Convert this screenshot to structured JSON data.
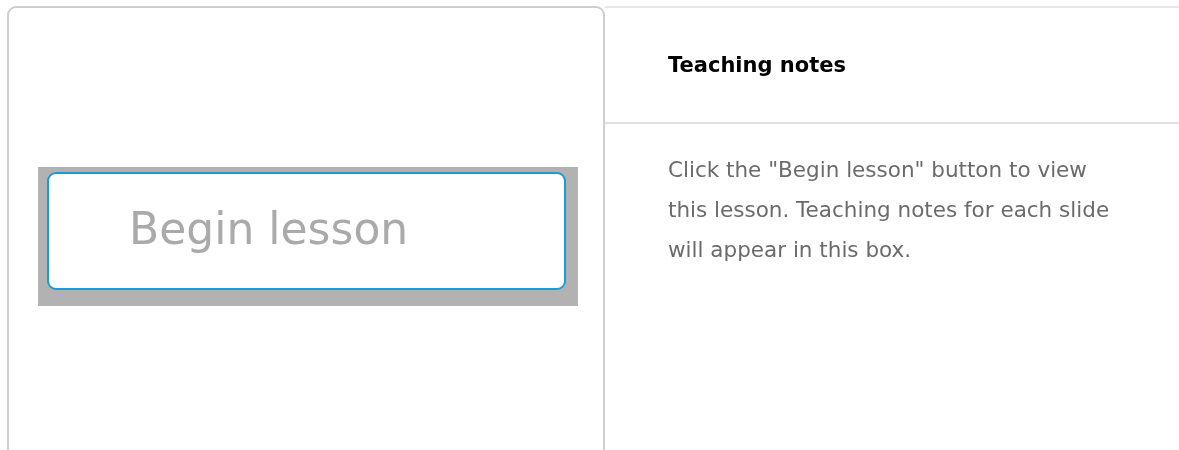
{
  "lesson_panel": {
    "begin_button": {
      "label": "Begin lesson"
    }
  },
  "notes_panel": {
    "title": "Teaching notes",
    "body": "Click the \"Begin lesson\" button to view this lesson. Teaching notes for each slide will appear in this box."
  }
}
